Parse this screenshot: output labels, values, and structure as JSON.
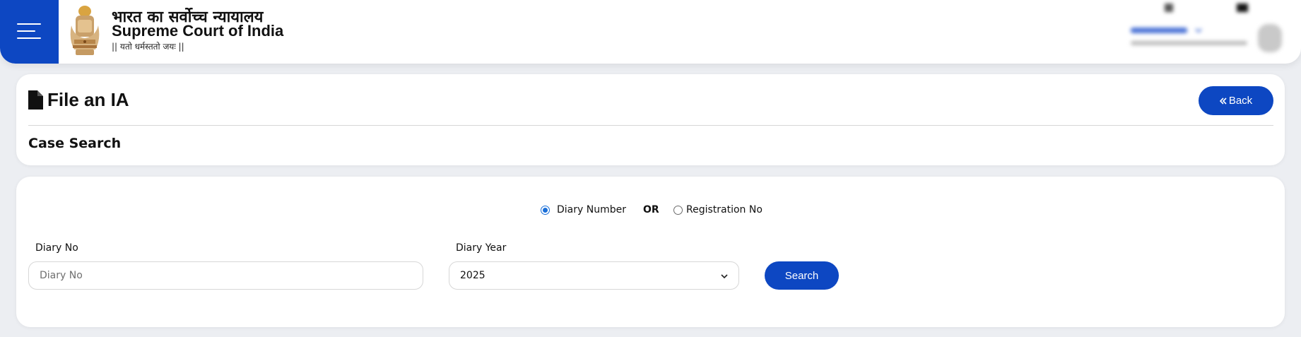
{
  "header": {
    "title_hindi": "भारत का सर्वोच्च न्यायालय",
    "title_english": "Supreme Court of India",
    "motto": "|| यतो धर्मस्ततो जयः ||",
    "menu_icon": "hamburger-icon",
    "logo_icon": "national-emblem-icon"
  },
  "page": {
    "title": "File an IA",
    "title_icon": "file-icon",
    "back_label": "Back",
    "back_icon": "double-chevron-left-icon",
    "section_title": "Case Search"
  },
  "search_form": {
    "radio_diary_label": "Diary Number",
    "or_label": "OR",
    "radio_registration_label": "Registration No",
    "selected_option": "Diary Number",
    "diary_no_label": "Diary No",
    "diary_no_placeholder": "Diary No",
    "diary_no_value": "",
    "diary_year_label": "Diary Year",
    "diary_year_value": "2025",
    "search_label": "Search"
  },
  "colors": {
    "primary": "#0d47c2",
    "radio_accent": "#1a6fd8",
    "background": "#eceef2"
  }
}
